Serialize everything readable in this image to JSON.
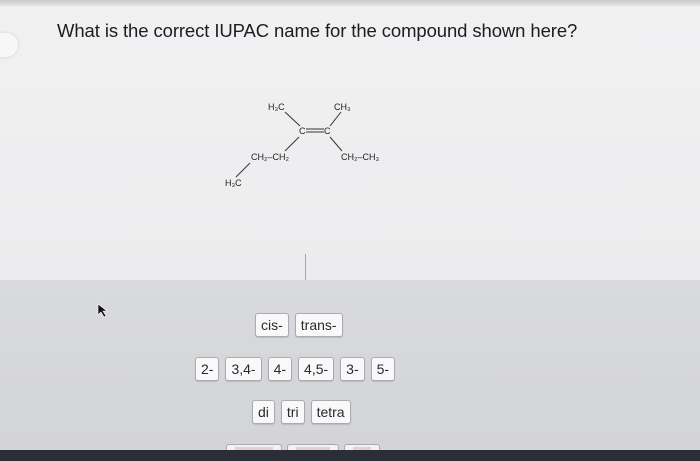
{
  "question": {
    "text": "What is the correct IUPAC name for the compound shown here?"
  },
  "structure": {
    "h3c_top": "H₃C",
    "ch3_top": "CH₃",
    "c_left": "C",
    "c_right": "C",
    "ch2ch2_left": "CH₂–CH₂",
    "ch2ch3_right": "CH₂–CH₃",
    "h3c_bottom": "H₃C"
  },
  "tiles": {
    "stereo": [
      "cis-",
      "trans-"
    ],
    "locants": [
      "2-",
      "3,4-",
      "4-",
      "4,5-",
      "3-",
      "5-"
    ],
    "multipliers": [
      "di",
      "tri",
      "tetra"
    ]
  }
}
